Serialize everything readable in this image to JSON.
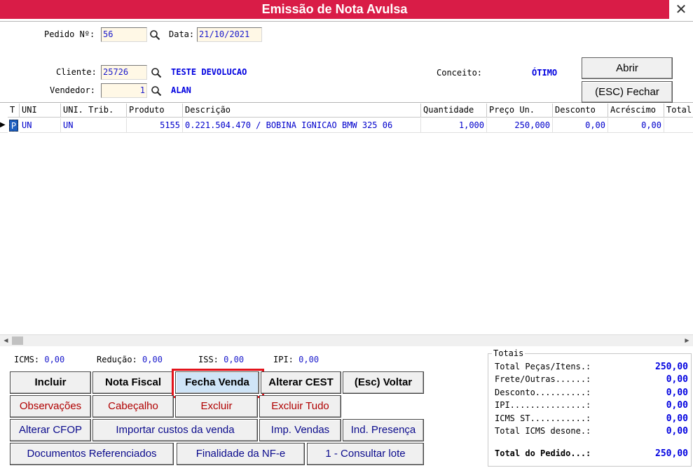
{
  "window": {
    "title": "Emissão de Nota Avulsa",
    "close_glyph": "✕"
  },
  "header": {
    "pedido_label": "Pedido Nº:",
    "pedido_value": "56",
    "data_label": "Data:",
    "data_value": "21/10/2021",
    "cliente_label": "Cliente:",
    "cliente_value": "25726",
    "cliente_name": "TESTE DEVOLUCAO",
    "vendedor_label": "Vendedor:",
    "vendedor_value": "1",
    "vendedor_name": "ALAN",
    "conceito_label": "Conceito:",
    "conceito_value": "ÓTIMO",
    "abrir_label": "Abrir",
    "fechar_label": "(ESC) Fechar"
  },
  "grid": {
    "columns": [
      "T",
      "UNI",
      "UNI. Trib.",
      "Produto",
      "Descrição",
      "Quantidade",
      "Preço Un.",
      "Desconto",
      "Acréscimo",
      "Total"
    ],
    "rows": [
      {
        "indicator": "▶",
        "t": "P",
        "uni": "UN",
        "uni_trib": "UN",
        "produto": "5155",
        "descricao": "0.221.504.470 / BOBINA IGNICAO  BMW 325 06",
        "quantidade": "1,000",
        "preco": "250,000",
        "desconto": "0,00",
        "acrescimo": "0,00",
        "total": ""
      }
    ]
  },
  "taxes": {
    "icms_label": "ICMS:",
    "icms_value": "0,00",
    "reducao_label": "Redução:",
    "reducao_value": "0,00",
    "iss_label": "ISS:",
    "iss_value": "0,00",
    "ipi_label": "IPI:",
    "ipi_value": "0,00"
  },
  "buttons": {
    "incluir": "Incluir",
    "nota_fiscal": "Nota Fiscal",
    "fecha_venda": "Fecha Venda",
    "alterar_cest": "Alterar CEST",
    "voltar": "(Esc) Voltar",
    "observacoes": "Observações",
    "cabecalho": "Cabeçalho",
    "excluir": "Excluir",
    "excluir_tudo": "Excluir Tudo",
    "alterar_cfop": "Alterar CFOP",
    "importar_custos": "Importar custos da venda",
    "imp_vendas": "Imp. Vendas",
    "ind_presenca": "Ind. Presença",
    "documentos_ref": "Documentos Referenciados",
    "finalidade": "Finalidade da NF-e",
    "consultar_lote": "1 - Consultar lote"
  },
  "totals": {
    "caption": "Totais",
    "rows": [
      {
        "label": "Total Peças/Itens.:",
        "value": "250,00"
      },
      {
        "label": "Frete/Outras......:",
        "value": "0,00"
      },
      {
        "label": "Desconto..........:",
        "value": "0,00"
      },
      {
        "label": "IPI...............:",
        "value": "0,00"
      },
      {
        "label": "ICMS ST...........:",
        "value": "0,00"
      },
      {
        "label": "Total ICMS desone.:",
        "value": "0,00"
      }
    ],
    "grand_label": "Total do Pedido...:",
    "grand_value": "250,00"
  },
  "colors": {
    "title_bar": "#d91c47",
    "highlight": "#e3131b",
    "value_blue": "#0000e0"
  }
}
